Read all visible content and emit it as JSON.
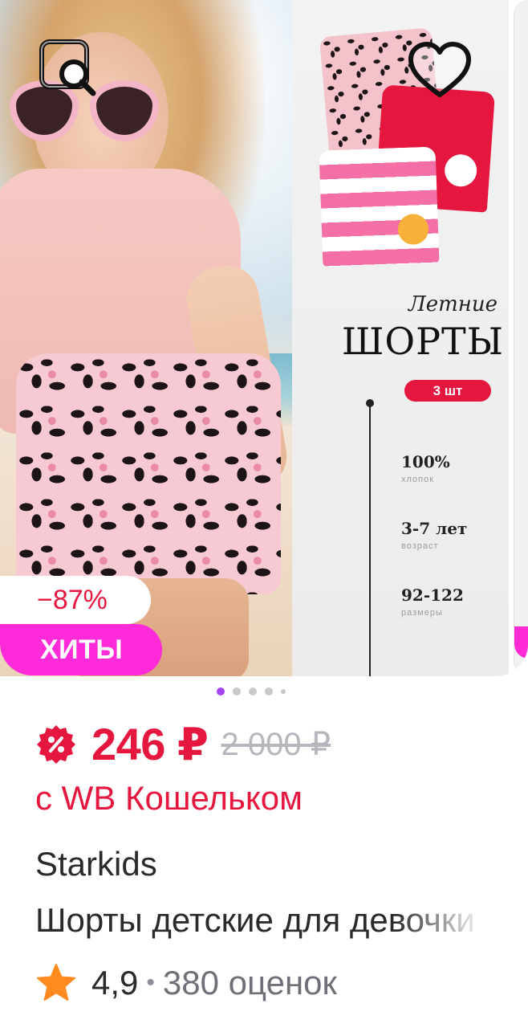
{
  "image_panel": {
    "subtitle": "Летние",
    "title": "ШОРТЫ",
    "pill": "3 шт",
    "specs": [
      {
        "value": "100%",
        "label": "хлопок"
      },
      {
        "value": "3-7 лет",
        "label": "возраст"
      },
      {
        "value": "92-122",
        "label": "размеры"
      }
    ]
  },
  "badges": {
    "discount": "−87%",
    "hits": "ХИТЫ"
  },
  "carousel": {
    "total_dots": 5,
    "active_index": 0
  },
  "price": {
    "current": "246 ₽",
    "old": "2 000 ₽",
    "wallet_text": "с WB Кошельком"
  },
  "product": {
    "brand": "Starkids",
    "title": "Шорты детские для девочки"
  },
  "rating": {
    "value": "4,9",
    "separator": "•",
    "reviews": "380 оценок"
  },
  "icons": {
    "similar": "image-search-icon",
    "favorite": "heart-icon",
    "wallet": "wallet-percent-icon",
    "star": "star-icon"
  },
  "colors": {
    "accent_red": "#e5173f",
    "hits_pink": "#ff2ad8",
    "dot_active": "#a247f2",
    "star_orange": "#ff8a1f",
    "old_price_gray": "#b6b6be"
  }
}
